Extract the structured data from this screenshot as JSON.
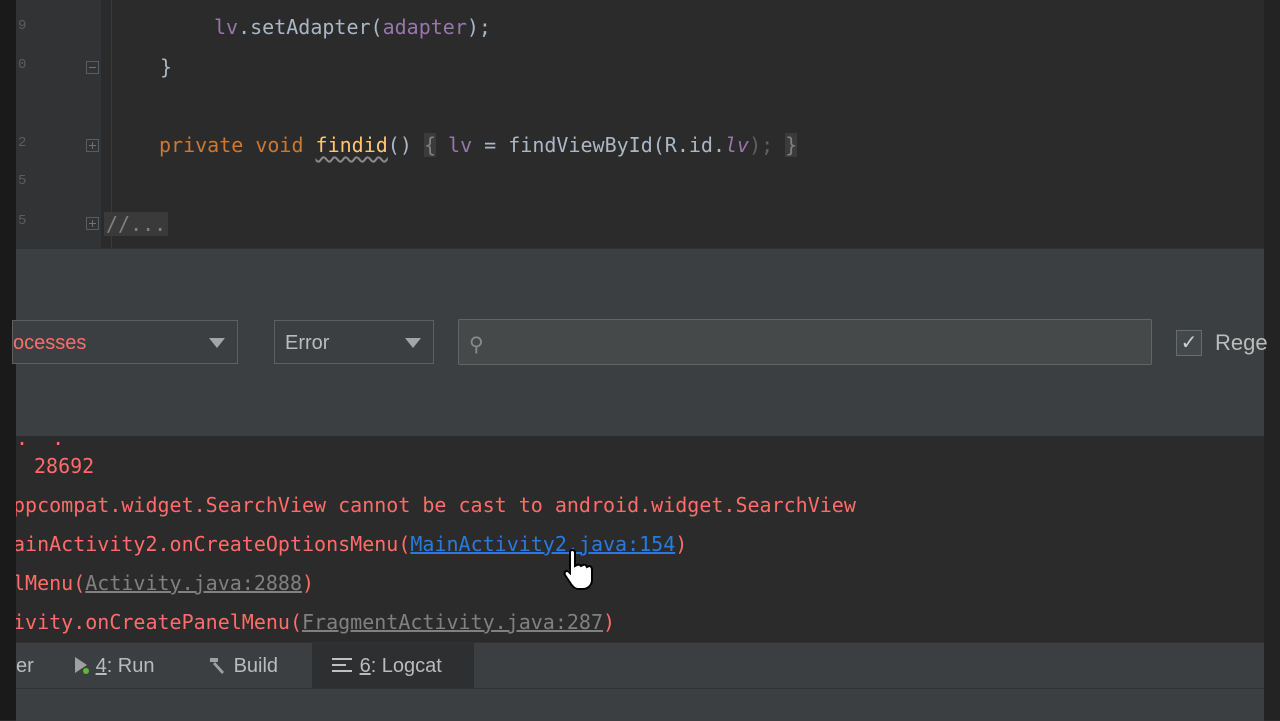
{
  "editor": {
    "line_numbers": [
      "9",
      "0",
      "2",
      "5",
      "5"
    ],
    "lines": {
      "set_adapter": {
        "object": "lv",
        "call": ".setAdapter(",
        "arg": "adapter",
        "end": ");"
      },
      "close_brace": "}",
      "findid": {
        "modifiers": "private void",
        "name": "findid",
        "parens": "()",
        "open": "{",
        "field": "lv",
        "assign": " = findViewById(R.id.",
        "id": "lv",
        "close": ");",
        "end": "}"
      },
      "folded": "//..."
    }
  },
  "logcat": {
    "process_combo": "ocesses",
    "level_combo": "Error",
    "search_placeholder": "",
    "regex_checked": true,
    "regex_label": "Rege"
  },
  "log": {
    "line0": "28692",
    "line1": "ppcompat.widget.SearchView cannot be cast to android.widget.SearchView",
    "line2_prefix": "ainActivity2.onCreateOptionsMenu(",
    "line2_link": "MainActivity2.java:154",
    "line2_suffix": ")",
    "line3_prefix": "lMenu(",
    "line3_link": "Activity.java:2888",
    "line3_suffix": ")",
    "line4_prefix": "ivity.onCreatePanelMenu(",
    "line4_link": "FragmentActivity.java:287",
    "line4_suffix": ")"
  },
  "toolbar": {
    "partial": "er",
    "run_num": "4",
    "run": ": Run",
    "build": "Build",
    "logcat_num": "6",
    "logcat": ": Logcat"
  },
  "colors": {
    "error_text": "#ff6b68",
    "link": "#287bde",
    "keyword": "#cc7832",
    "method": "#ffc66d",
    "field": "#9876aa"
  }
}
